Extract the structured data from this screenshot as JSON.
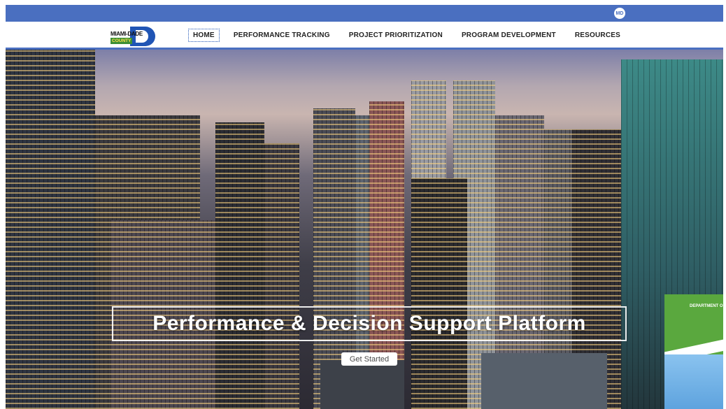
{
  "header": {
    "user_initials": "MD"
  },
  "logo": {
    "name": "MIAMI-DADE",
    "county": "COUNTY"
  },
  "nav": {
    "items": [
      {
        "label": "HOME",
        "active": true
      },
      {
        "label": "PERFORMANCE TRACKING",
        "active": false
      },
      {
        "label": "PROJECT PRIORITIZATION",
        "active": false
      },
      {
        "label": "PROGRAM DEVELOPMENT",
        "active": false
      },
      {
        "label": "RESOURCES",
        "active": false
      }
    ]
  },
  "hero": {
    "title": "Performance & Decision Support Platform",
    "cta_label": "Get Started"
  },
  "side_card": {
    "label": "DEPARTMENT O"
  },
  "colors": {
    "brand_blue": "#4a6fc0",
    "logo_blue": "#2055b5",
    "logo_green": "#3c8f36",
    "card_green": "#5aa83e"
  }
}
